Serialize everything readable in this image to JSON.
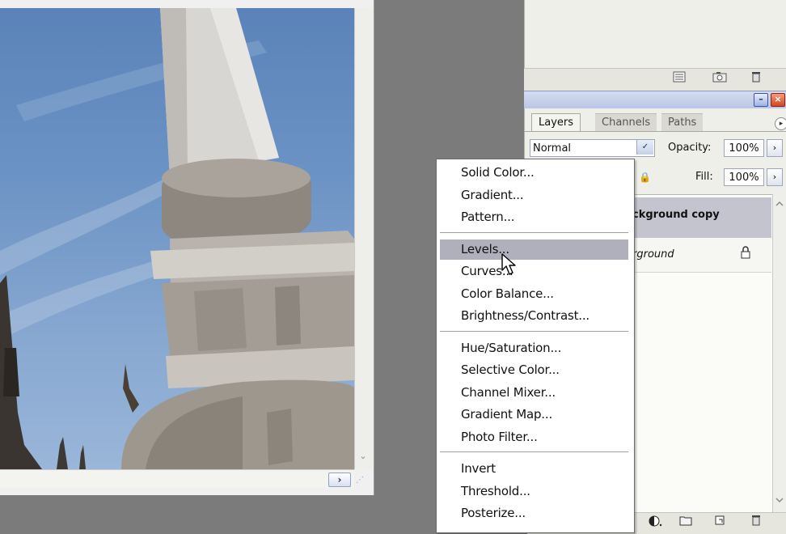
{
  "document": {
    "scroll_down_glyph": "⌄",
    "scroll_right_glyph": "›",
    "resize_glyph": "⋰"
  },
  "top_panel": {
    "icons": [
      "list-icon",
      "camera-icon",
      "trash-icon"
    ]
  },
  "panel_window": {
    "minimize_glyph": "–",
    "close_glyph": "×"
  },
  "layers_panel": {
    "tabs": [
      {
        "label": "Layers"
      },
      {
        "label": "Channels"
      },
      {
        "label": "Paths"
      }
    ],
    "menu_glyph": "▸",
    "blend_mode": "Normal",
    "dropdown_glyph": "✓",
    "opacity_label": "Opacity:",
    "opacity_value": "100%",
    "fill_label": "Fill:",
    "fill_value": "100%",
    "stepper_glyph": "›",
    "lock_glyph": "🔒",
    "layers": [
      {
        "name": "ckground copy",
        "selected": true
      },
      {
        "name": "rground",
        "locked": true
      }
    ],
    "bottom_icons": [
      "adjustment-layer-icon",
      "folder-icon",
      "new-layer-icon",
      "trash-icon"
    ]
  },
  "context_menu": {
    "groups": [
      [
        "Solid Color...",
        "Gradient...",
        "Pattern..."
      ],
      [
        "Levels...",
        "Curves...",
        "Color Balance...",
        "Brightness/Contrast..."
      ],
      [
        "Hue/Saturation...",
        "Selective Color...",
        "Channel Mixer...",
        "Gradient Map...",
        "Photo Filter..."
      ],
      [
        "Invert",
        "Threshold...",
        "Posterize..."
      ]
    ],
    "highlighted": "Levels..."
  },
  "colors": {
    "menu_highlight": "#b0b0bd",
    "selected_layer": "#c4c4cf",
    "workspace": "#7b7b7b"
  }
}
